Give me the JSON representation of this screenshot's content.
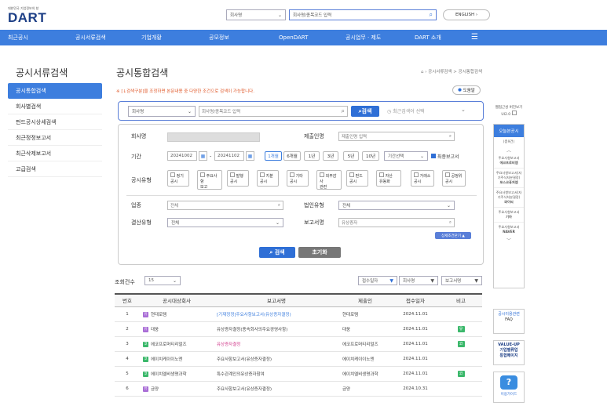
{
  "header": {
    "logo_sub": "대한민국 기업정보의 창",
    "logo": "DART",
    "search_type": "회사명",
    "search_placeholder": "회사명/종목코드 입력",
    "english": "ENGLISH"
  },
  "nav": [
    "최근공시",
    "공시서류검색",
    "기업개황",
    "공모정보",
    "OpenDART",
    "공시업무 · 제도",
    "DART 소개"
  ],
  "sidebar": {
    "title": "공시서류검색",
    "items": [
      {
        "label": "공시통합검색",
        "active": true
      },
      {
        "label": "회사별검색"
      },
      {
        "label": "펀드공시상세검색"
      },
      {
        "label": "최근정정보고서"
      },
      {
        "label": "최근삭제보고서"
      },
      {
        "label": "고급검색"
      }
    ]
  },
  "main": {
    "title": "공시통합검색",
    "breadcrumb": "공시서류검색 > 공시통합검색",
    "notice": "※ [↓검색구분]을 조정하면 본문내용 중 다양한 조건으로 검색이 가능합니다.",
    "help": "도움말",
    "search": {
      "type": "회사명",
      "placeholder": "회사명/종목코드 입력",
      "button": "검색",
      "recent": "최근검색어 선택"
    },
    "form": {
      "company_label": "회사명",
      "submitter_label": "제출인명",
      "submitter_placeholder": "제출인명 입력",
      "period_label": "기간",
      "date_from": "20241002",
      "date_to": "20241102",
      "periods": [
        "1개월",
        "6개월",
        "1년",
        "3년",
        "5년",
        "10년"
      ],
      "period_select": "기간선택",
      "final_report": "최종보고서",
      "type_label": "공시유형",
      "types": [
        "정기\n공시",
        "주요사항\n보고",
        "발행\n공시",
        "지분\n공시",
        "기타\n공시",
        "외부감사\n관련",
        "펀드\n공시",
        "자산\n유동화",
        "거래소\n공시",
        "공정위\n공시"
      ],
      "industry_label": "업종",
      "industry_value": "전체",
      "corp_type_label": "법인유형",
      "corp_type_value": "전체",
      "settle_label": "결산유형",
      "settle_value": "전체",
      "report_label": "보고서명",
      "report_placeholder": "유상증자",
      "detail_toggle": "상세조건닫기 ▲",
      "search_button": "검색",
      "reset_button": "초기화"
    },
    "results": {
      "count_label": "조회건수",
      "count_value": "15",
      "sort1": "접수일자",
      "sort2": "회사명",
      "sort3": "보고서명",
      "columns": [
        "번호",
        "공시대상회사",
        "보고서명",
        "제출인",
        "접수일자",
        "비고"
      ],
      "rows": [
        {
          "no": "1",
          "mkt": "유",
          "company": "현대로템",
          "report": "[기재정정]주요사항보고서(유상증자결정)",
          "submitter": "현대로템",
          "date": "2024.11.01",
          "note": ""
        },
        {
          "no": "2",
          "mkt": "유",
          "company": "대웅",
          "report": "유상증자결정(종속회사의주요경영사항)",
          "submitter": "대웅",
          "date": "2024.11.01",
          "note": "유"
        },
        {
          "no": "3",
          "mkt": "코",
          "company": "에코프로머티리얼즈",
          "report": "유상증자결정",
          "submitter": "에코프로머티리얼즈",
          "date": "2024.11.01",
          "note": "코"
        },
        {
          "no": "4",
          "mkt": "코",
          "company": "에이치케이이노엔",
          "report": "주요사항보고서(유상증자결정)",
          "submitter": "에이치케이이노엔",
          "date": "2024.11.01",
          "note": ""
        },
        {
          "no": "5",
          "mkt": "코",
          "company": "에이치엘비생명과학",
          "report": "특수관계인의유상증자참여",
          "submitter": "에이치엘비생명과학",
          "date": "2024.11.01",
          "note": "코"
        },
        {
          "no": "6",
          "mkt": "유",
          "company": "금양",
          "report": "주요사항보고서(유상증자결정)",
          "submitter": "금양",
          "date": "2024.10.31",
          "note": ""
        }
      ]
    }
  },
  "rail": {
    "top_label": "웹접근성 버전보기",
    "toggle": "UI2.0",
    "title": "오늘본공시",
    "count": "(총9건)",
    "items": [
      {
        "desc": "주요사항보고서",
        "name": "에코프로비엠"
      },
      {
        "desc": "주요사항보고서(자기주식처분결정)",
        "name": "포스코퓨처엠"
      },
      {
        "desc": "주요사항보고서(자기주식처분결정)",
        "name": "와이씨"
      },
      {
        "desc": "주요사항보고서",
        "name": "기아"
      },
      {
        "desc": "주요사항보고서",
        "name": "NAVER"
      }
    ],
    "faq_title": "공시이용관련",
    "faq": "FAQ",
    "valueup": "VALUE-UP\n기업밸류업\n통합페이지",
    "guide": "이용가이드"
  },
  "colors": {
    "primary": "#3d7ede",
    "accent": "#e0592a",
    "badge_yu": "#a96dd6",
    "badge_ko": "#3bb86b"
  }
}
